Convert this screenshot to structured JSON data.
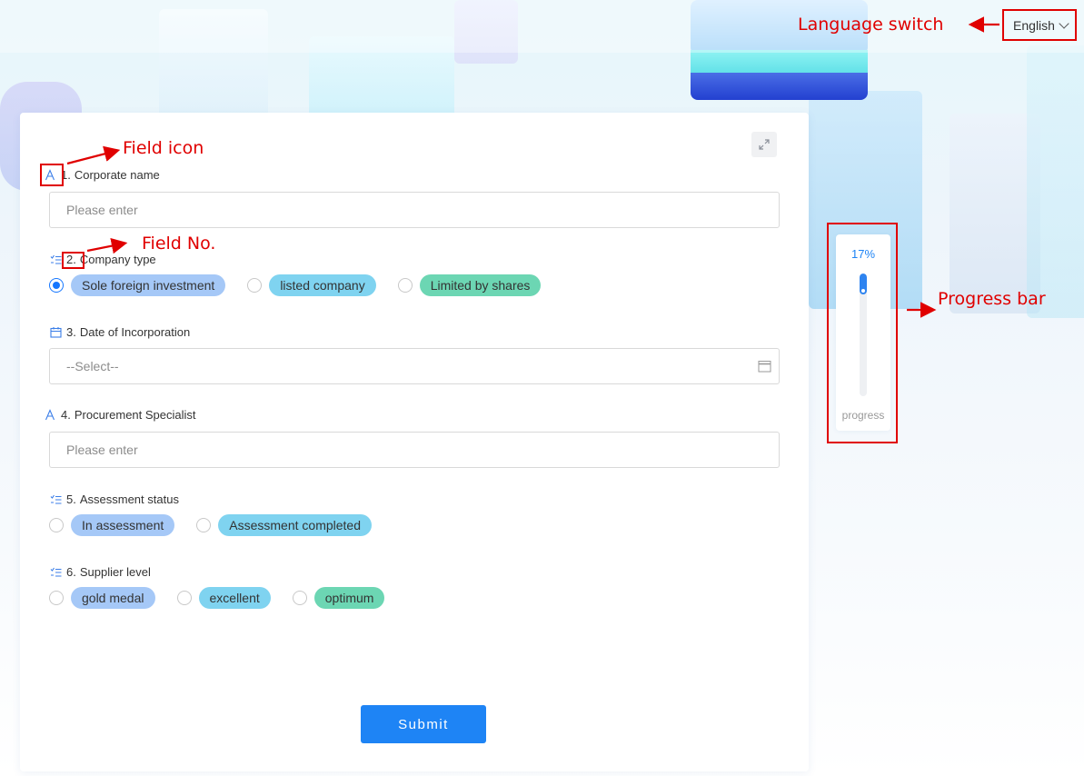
{
  "header": {
    "language": "English"
  },
  "form": {
    "fields": [
      {
        "no": "1.",
        "label": "Corporate name",
        "icon": "text-icon",
        "placeholder": "Please enter"
      },
      {
        "no": "2.",
        "label": "Company type",
        "icon": "list-icon",
        "options": [
          {
            "label": "Sole foreign investment",
            "color": "#a5c8f7",
            "checked": true
          },
          {
            "label": "listed company",
            "color": "#7fd3f0",
            "checked": false
          },
          {
            "label": "Limited by shares",
            "color": "#6cd6b3",
            "checked": false
          }
        ]
      },
      {
        "no": "3.",
        "label": "Date of Incorporation",
        "icon": "calendar-icon",
        "placeholder": "--Select--"
      },
      {
        "no": "4.",
        "label": "Procurement Specialist",
        "icon": "text-icon",
        "placeholder": "Please enter"
      },
      {
        "no": "5.",
        "label": "Assessment status",
        "icon": "list-icon",
        "options": [
          {
            "label": "In assessment",
            "color": "#a5c8f7",
            "checked": false
          },
          {
            "label": "Assessment completed",
            "color": "#7fd3f0",
            "checked": false
          }
        ]
      },
      {
        "no": "6.",
        "label": "Supplier level",
        "icon": "list-icon",
        "options": [
          {
            "label": "gold medal",
            "color": "#a5c8f7",
            "checked": false
          },
          {
            "label": "excellent",
            "color": "#7fd3f0",
            "checked": false
          },
          {
            "label": "optimum",
            "color": "#6cd6b3",
            "checked": false
          }
        ]
      }
    ],
    "submit_label": "Submit"
  },
  "progress": {
    "percent_text": "17%",
    "value": 0.17,
    "label": "progress"
  },
  "annotations": {
    "field_icon": "Field icon",
    "field_no": "Field No.",
    "language_switch": "Language switch",
    "progress_bar": "Progress bar"
  },
  "colors": {
    "accent": "#1e84f5",
    "annotation": "#e00000"
  }
}
